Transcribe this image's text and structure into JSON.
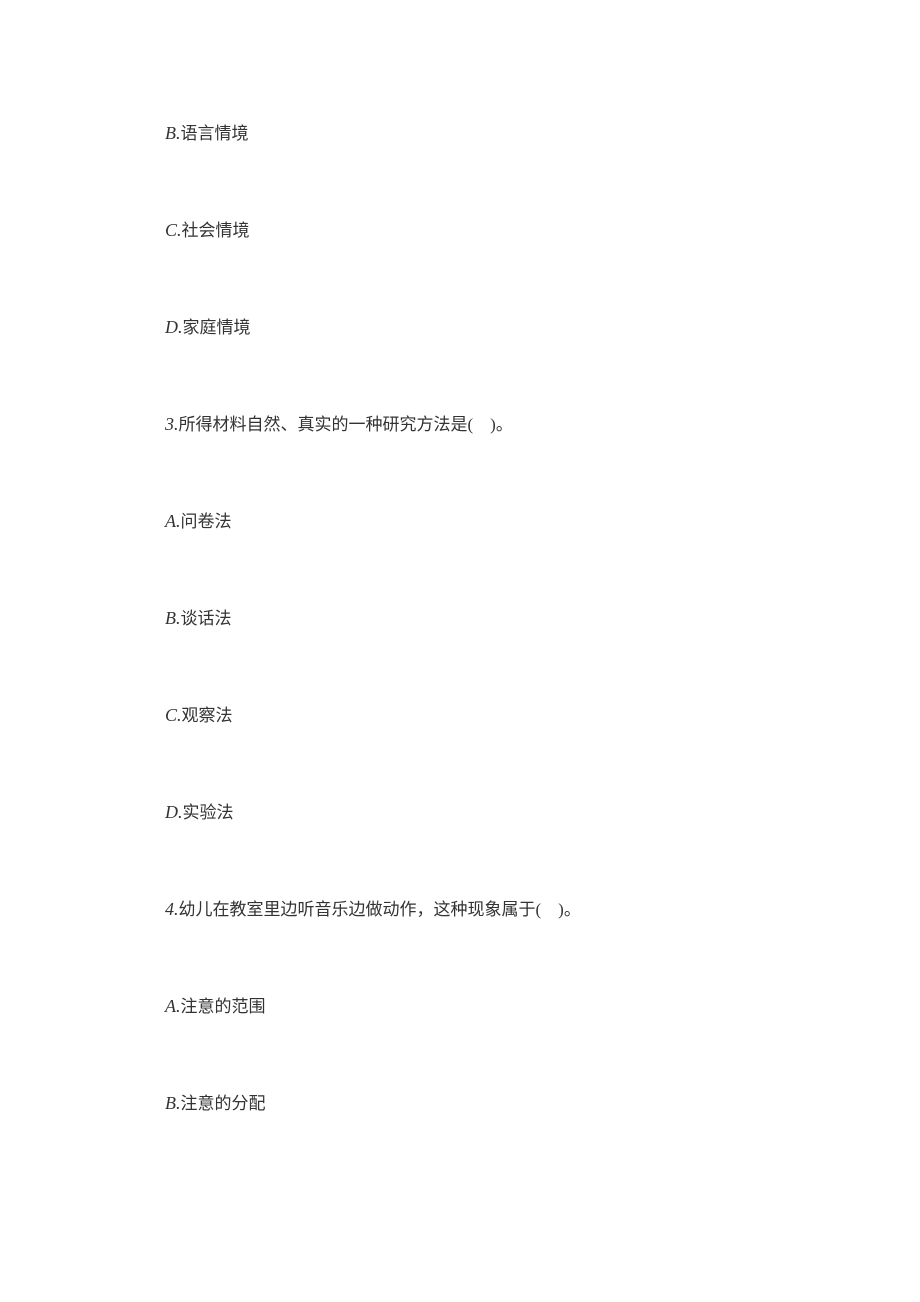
{
  "q2_options": {
    "b": {
      "letter": "B.",
      "text": "语言情境"
    },
    "c": {
      "letter": "C.",
      "text": "社会情境"
    },
    "d": {
      "letter": "D.",
      "text": "家庭情境"
    }
  },
  "q3": {
    "num": "3.",
    "text": "所得材料自然、真实的一种研究方法是(　)。",
    "a": {
      "letter": "A.",
      "text": "问卷法"
    },
    "b": {
      "letter": "B.",
      "text": "谈话法"
    },
    "c": {
      "letter": "C.",
      "text": "观察法"
    },
    "d": {
      "letter": "D.",
      "text": "实验法"
    }
  },
  "q4": {
    "num": "4.",
    "text": "幼儿在教室里边听音乐边做动作，这种现象属于(　)。",
    "a": {
      "letter": "A.",
      "text": "注意的范围"
    },
    "b": {
      "letter": "B.",
      "text": "注意的分配"
    }
  }
}
